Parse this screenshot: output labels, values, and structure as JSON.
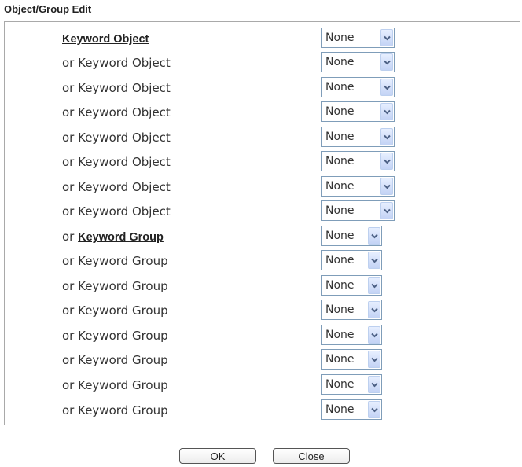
{
  "header": {
    "title": "Object/Group Edit"
  },
  "rows": [
    {
      "prefix": "",
      "link": "Keyword Object",
      "rest": "",
      "value": "None",
      "kind": "obj"
    },
    {
      "prefix": "",
      "link": "",
      "rest": "or Keyword Object",
      "value": "None",
      "kind": "obj"
    },
    {
      "prefix": "",
      "link": "",
      "rest": "or Keyword Object",
      "value": "None",
      "kind": "obj"
    },
    {
      "prefix": "",
      "link": "",
      "rest": "or Keyword Object",
      "value": "None",
      "kind": "obj"
    },
    {
      "prefix": "",
      "link": "",
      "rest": "or Keyword Object",
      "value": "None",
      "kind": "obj"
    },
    {
      "prefix": "",
      "link": "",
      "rest": "or Keyword Object",
      "value": "None",
      "kind": "obj"
    },
    {
      "prefix": "",
      "link": "",
      "rest": "or Keyword Object",
      "value": "None",
      "kind": "obj"
    },
    {
      "prefix": "",
      "link": "",
      "rest": "or Keyword Object",
      "value": "None",
      "kind": "obj"
    },
    {
      "prefix": "or ",
      "link": "Keyword Group",
      "rest": "",
      "value": "None",
      "kind": "grp"
    },
    {
      "prefix": "",
      "link": "",
      "rest": "or Keyword Group",
      "value": "None",
      "kind": "grp"
    },
    {
      "prefix": "",
      "link": "",
      "rest": "or Keyword Group",
      "value": "None",
      "kind": "grp"
    },
    {
      "prefix": "",
      "link": "",
      "rest": "or Keyword Group",
      "value": "None",
      "kind": "grp"
    },
    {
      "prefix": "",
      "link": "",
      "rest": "or Keyword Group",
      "value": "None",
      "kind": "grp"
    },
    {
      "prefix": "",
      "link": "",
      "rest": "or Keyword Group",
      "value": "None",
      "kind": "grp"
    },
    {
      "prefix": "",
      "link": "",
      "rest": "or Keyword Group",
      "value": "None",
      "kind": "grp"
    },
    {
      "prefix": "",
      "link": "",
      "rest": "or Keyword Group",
      "value": "None",
      "kind": "grp"
    }
  ],
  "icons": {
    "dropdown": "chevron-down-icon"
  },
  "colors": {
    "border": "#a9a9a9",
    "select_border": "#7f9db9",
    "arrow": "#4d6185"
  },
  "buttons": {
    "ok": "OK",
    "close": "Close"
  }
}
